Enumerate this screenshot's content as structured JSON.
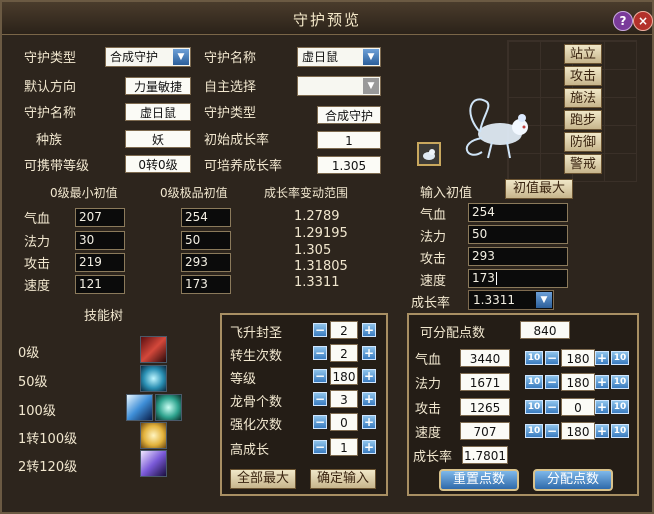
{
  "window": {
    "title": "守护预览"
  },
  "header_buttons": {
    "help": "?",
    "close": "×"
  },
  "info": {
    "type_label": "守护类型",
    "type_select": "合成守护",
    "name_label": "守护名称",
    "name_select": "虚日鼠",
    "default_dir_label": "默认方向",
    "default_dir_value": "力量敏捷",
    "auto_select_label": "自主选择",
    "auto_select_value": "",
    "name_label2": "守护名称",
    "name_value2": "虚日鼠",
    "type_label2": "守护类型",
    "type_value2": "合成守护",
    "race_label": "种族",
    "race_value": "妖",
    "init_growth_label": "初始成长率",
    "init_growth_value": "1",
    "carry_level_label": "可携带等级",
    "carry_level_value": "0转0级",
    "cultivable_growth_label": "可培养成长率",
    "cultivable_growth_value": "1.305"
  },
  "base_table": {
    "min_header": "0级最小初值",
    "best_header": "0级极品初值",
    "growth_header": "成长率变动范围",
    "rows": [
      {
        "label": "气血",
        "min": "207",
        "best": "254"
      },
      {
        "label": "法力",
        "min": "30",
        "best": "50"
      },
      {
        "label": "攻击",
        "min": "219",
        "best": "293"
      },
      {
        "label": "速度",
        "min": "121",
        "best": "173"
      }
    ],
    "growth_values": [
      "1.2789",
      "1.29195",
      "1.305",
      "1.31805",
      "1.3311"
    ]
  },
  "commands": [
    "站立",
    "攻击",
    "施法",
    "跑步",
    "防御",
    "警戒"
  ],
  "input": {
    "label": "输入初值",
    "max_button": "初值最大",
    "rows": [
      {
        "label": "气血",
        "value": "254"
      },
      {
        "label": "法力",
        "value": "50"
      },
      {
        "label": "攻击",
        "value": "293"
      },
      {
        "label": "速度",
        "value": "173"
      }
    ],
    "growth_label": "成长率",
    "growth_value": "1.3311"
  },
  "skill_tree": {
    "title": "技能树",
    "levels": [
      "0级",
      "50级",
      "100级",
      "1转100级",
      "2转120级"
    ],
    "icons": [
      "skill-blade-icon",
      "skill-spirit-icon",
      "skill-strike-icon",
      "skill-golden-icon",
      "skill-crystal-icon"
    ]
  },
  "controls": {
    "rows": [
      {
        "label": "飞升封圣",
        "value": "2"
      },
      {
        "label": "转生次数",
        "value": "2"
      },
      {
        "label": "等级",
        "value": "180"
      },
      {
        "label": "龙骨个数",
        "value": "3"
      },
      {
        "label": "强化次数",
        "value": "0"
      },
      {
        "label": "高成长",
        "value": "1"
      }
    ],
    "max_all": "全部最大",
    "confirm": "确定输入"
  },
  "alloc": {
    "points_label": "可分配点数",
    "points_value": "840",
    "rows": [
      {
        "label": "气血",
        "value": "3440",
        "alloc": "180"
      },
      {
        "label": "法力",
        "value": "1671",
        "alloc": "180"
      },
      {
        "label": "攻击",
        "value": "1265",
        "alloc": "0"
      },
      {
        "label": "速度",
        "value": "707",
        "alloc": "180"
      }
    ],
    "ten_label": "10",
    "growth_label": "成长率",
    "growth_value": "1.7801",
    "reset_button": "重置点数",
    "assign_button": "分配点数"
  },
  "colors": {
    "panel_border": "#a88f63",
    "text": "#f1e7cf",
    "accent_blue": "#3a7cc0"
  }
}
